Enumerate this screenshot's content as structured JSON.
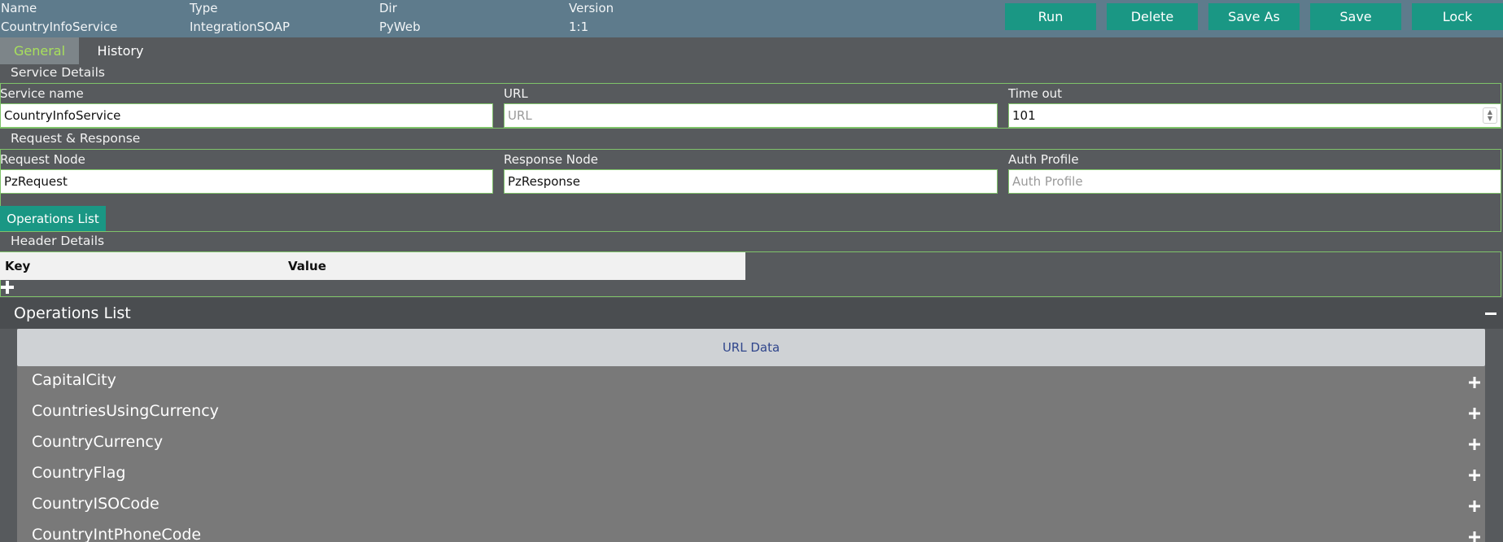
{
  "header": {
    "fields": [
      {
        "label": "Name",
        "value": "CountryInfoService"
      },
      {
        "label": "Type",
        "value": "IntegrationSOAP"
      },
      {
        "label": "Dir",
        "value": "PyWeb"
      },
      {
        "label": "Version",
        "value": "1:1"
      }
    ],
    "buttons": [
      "Run",
      "Delete",
      "Save As",
      "Save",
      "Lock"
    ],
    "accent_color": "#1a9784",
    "bar_color": "#5e7b8c"
  },
  "tabs": [
    {
      "label": "General",
      "active": true
    },
    {
      "label": "History",
      "active": false
    }
  ],
  "service_details": {
    "title": "Service Details",
    "service_name": {
      "label": "Service name",
      "value": "CountryInfoService"
    },
    "url": {
      "label": "URL",
      "value": "",
      "placeholder": "URL"
    },
    "timeout": {
      "label": "Time out",
      "value": "101"
    }
  },
  "request_response": {
    "title": "Request & Response",
    "request_node": {
      "label": "Request Node",
      "value": "PzRequest"
    },
    "response_node": {
      "label": "Response Node",
      "value": "PzResponse"
    },
    "auth_profile": {
      "label": "Auth Profile",
      "value": "",
      "placeholder": "Auth Profile"
    },
    "operations_button": "Operations List"
  },
  "header_details": {
    "title": "Header Details",
    "columns": [
      "Key",
      "Value"
    ],
    "add_icon": "plus-icon"
  },
  "operations": {
    "title": "Operations List",
    "collapse_icon": "minus-icon",
    "url_data_label": "URL Data",
    "items": [
      "CapitalCity",
      "CountriesUsingCurrency",
      "CountryCurrency",
      "CountryFlag",
      "CountryISOCode",
      "CountryIntPhoneCode"
    ]
  }
}
